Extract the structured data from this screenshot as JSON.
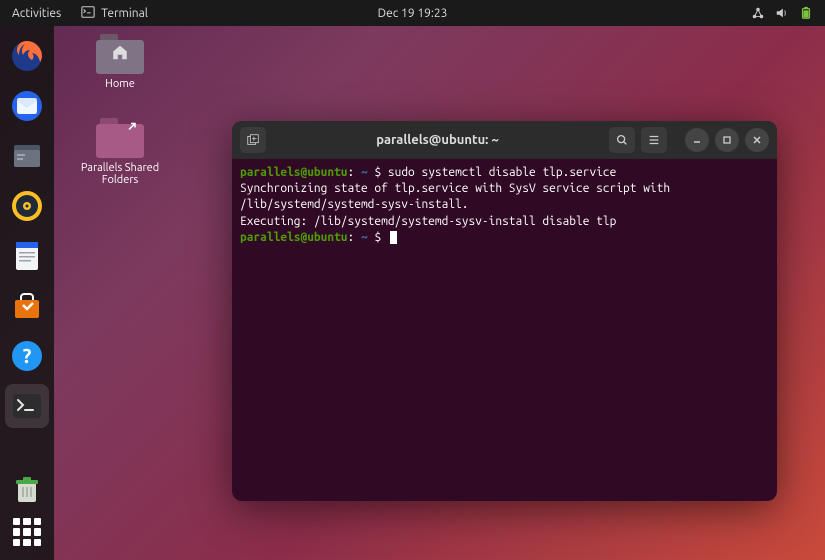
{
  "topbar": {
    "activities": "Activities",
    "app_label": "Terminal",
    "datetime": "Dec 19  19:23"
  },
  "desktop": {
    "icons": [
      {
        "label": "Home"
      },
      {
        "label": "Parallels Shared Folders"
      }
    ]
  },
  "terminal": {
    "title": "parallels@ubuntu: ~",
    "prompt_user": "parallels@ubuntu",
    "prompt_path": "~",
    "lines": [
      {
        "type": "cmd",
        "text": "sudo systemctl disable tlp.service"
      },
      {
        "type": "out",
        "text": "Synchronizing state of tlp.service with SysV service script with /lib/systemd/systemd-sysv-install."
      },
      {
        "type": "out",
        "text": "Executing: /lib/systemd/systemd-sysv-install disable tlp"
      },
      {
        "type": "cmd",
        "text": ""
      }
    ]
  },
  "dock": {
    "items": [
      "firefox",
      "thunderbird",
      "files",
      "rhythmbox",
      "writer",
      "software",
      "help",
      "terminal",
      "trash"
    ]
  }
}
